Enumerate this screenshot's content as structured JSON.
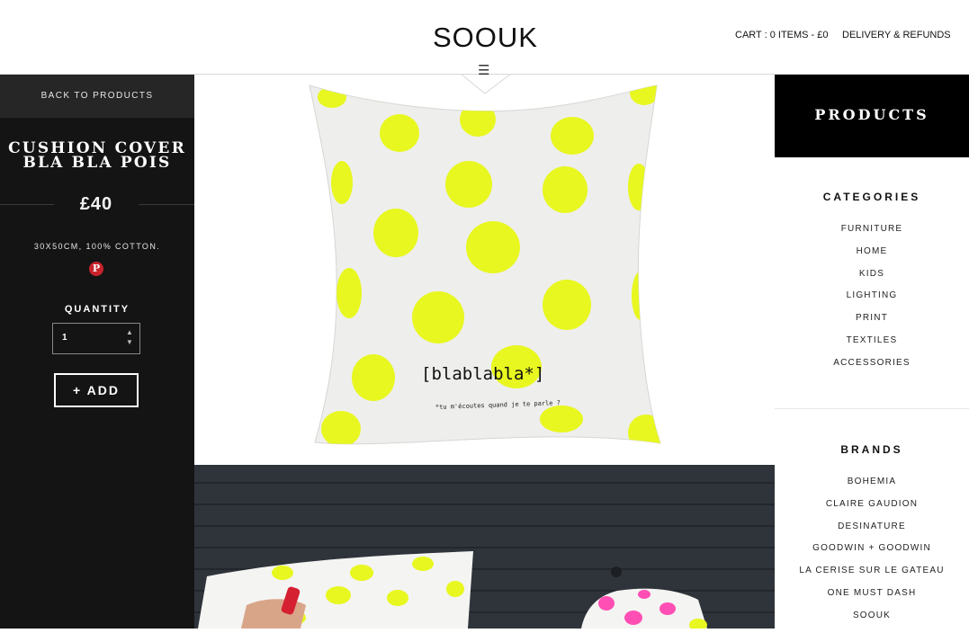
{
  "header": {
    "logo": "SOOUK",
    "cart": "CART : 0 ITEMS - £0",
    "delivery": "DELIVERY & REFUNDS",
    "menu_icon": "hamburger-icon"
  },
  "product": {
    "back": "BACK TO PRODUCTS",
    "title": "CUSHION COVER BLA BLA POIS",
    "price": "£40",
    "description": "30X50CM, 100% COTTON.",
    "pinterest_icon": "pinterest-icon",
    "quantity_label": "QUANTITY",
    "quantity_value": "1",
    "add_label": "+ ADD"
  },
  "image": {
    "cushion_text": "[blablabla*]",
    "cushion_subtext": "*tu m'écoutes quand je te parle ?"
  },
  "sidebar": {
    "products": "PRODUCTS",
    "categories_title": "CATEGORIES",
    "categories": [
      "FURNITURE",
      "HOME",
      "KIDS",
      "LIGHTING",
      "PRINT",
      "TEXTILES",
      "ACCESSORIES"
    ],
    "brands_title": "BRANDS",
    "brands": [
      "BOHEMIA",
      "CLAIRE GAUDION",
      "DESINATURE",
      "GOODWIN + GOODWIN",
      "LA CERISE SUR LE GATEAU",
      "ONE MUST DASH",
      "SOOUK"
    ]
  },
  "colors": {
    "accent": "#e8f71f",
    "dark": "#141414",
    "pinterest": "#c8232c"
  }
}
